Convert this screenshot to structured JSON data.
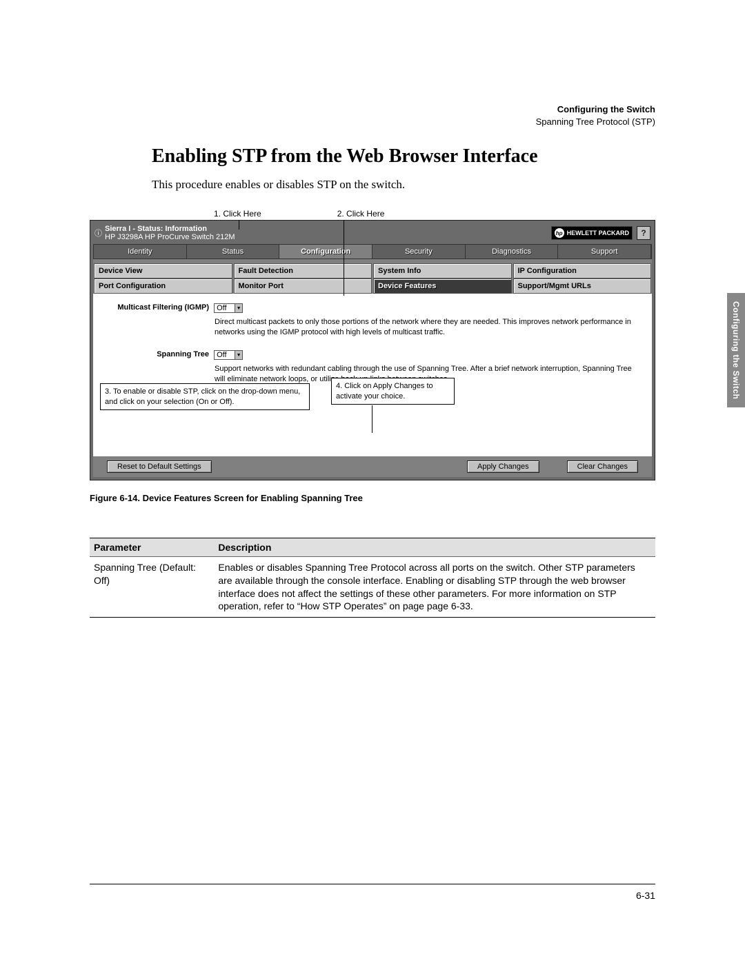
{
  "header": {
    "chapter": "Configuring the Switch",
    "subtitle": "Spanning Tree Protocol (STP)"
  },
  "side_tab": "Configuring the Switch",
  "section_title": "Enabling STP from the Web Browser Interface",
  "intro": "This procedure enables or disables STP on the switch.",
  "callouts": {
    "c1": "1. Click Here",
    "c2": "2. Click Here",
    "c3": "3. To enable or disable STP, click on the drop-down menu, and click on your selection (On or Off).",
    "c4": "4. Click on Apply Changes to activate your choice."
  },
  "shot": {
    "info_icon": "ⓘ",
    "title_bold": "Sierra I - Status: Information",
    "title_sub": "HP J3298A HP ProCurve Switch 212M",
    "logo_text": "HEWLETT PACKARD",
    "logo_mark": "hp",
    "help_mark": "?",
    "tabs": [
      "Identity",
      "Status",
      "Configuration",
      "Security",
      "Diagnostics",
      "Support"
    ],
    "subtabs_row1": [
      "Device View",
      "Fault Detection",
      "System Info",
      "IP Configuration"
    ],
    "subtabs_row2": [
      "Port Configuration",
      "Monitor Port",
      "Device Features",
      "Support/Mgmt URLs"
    ],
    "field1_label": "Multicast Filtering (IGMP)",
    "field1_value": "Off",
    "field1_desc": "Direct multicast packets to only those portions of the network where they are needed. This improves network performance in networks using the IGMP protocol with high levels of multicast traffic.",
    "field2_label": "Spanning Tree",
    "field2_value": "Off",
    "field2_desc": "Support networks with redundant cabling through the use of Spanning Tree. After a brief network interruption, Spanning Tree will eliminate network loops, or utilize back-up links between switches.",
    "buttons": {
      "reset": "Reset to Default Settings",
      "apply": "Apply Changes",
      "clear": "Clear Changes"
    }
  },
  "figure_caption": "Figure 6-14.  Device Features Screen for Enabling Spanning Tree",
  "table": {
    "h1": "Parameter",
    "h2": "Description",
    "row_param": "Spanning Tree (Default: Off)",
    "row_desc": "Enables or disables Spanning Tree Protocol across all ports on the switch. Other STP parameters are available through the console interface. Enabling or disabling STP through the web browser interface does not affect the settings of these other parameters. For more information on STP operation, refer to “How STP Operates” on page page 6-33."
  },
  "page_number": "6-31"
}
